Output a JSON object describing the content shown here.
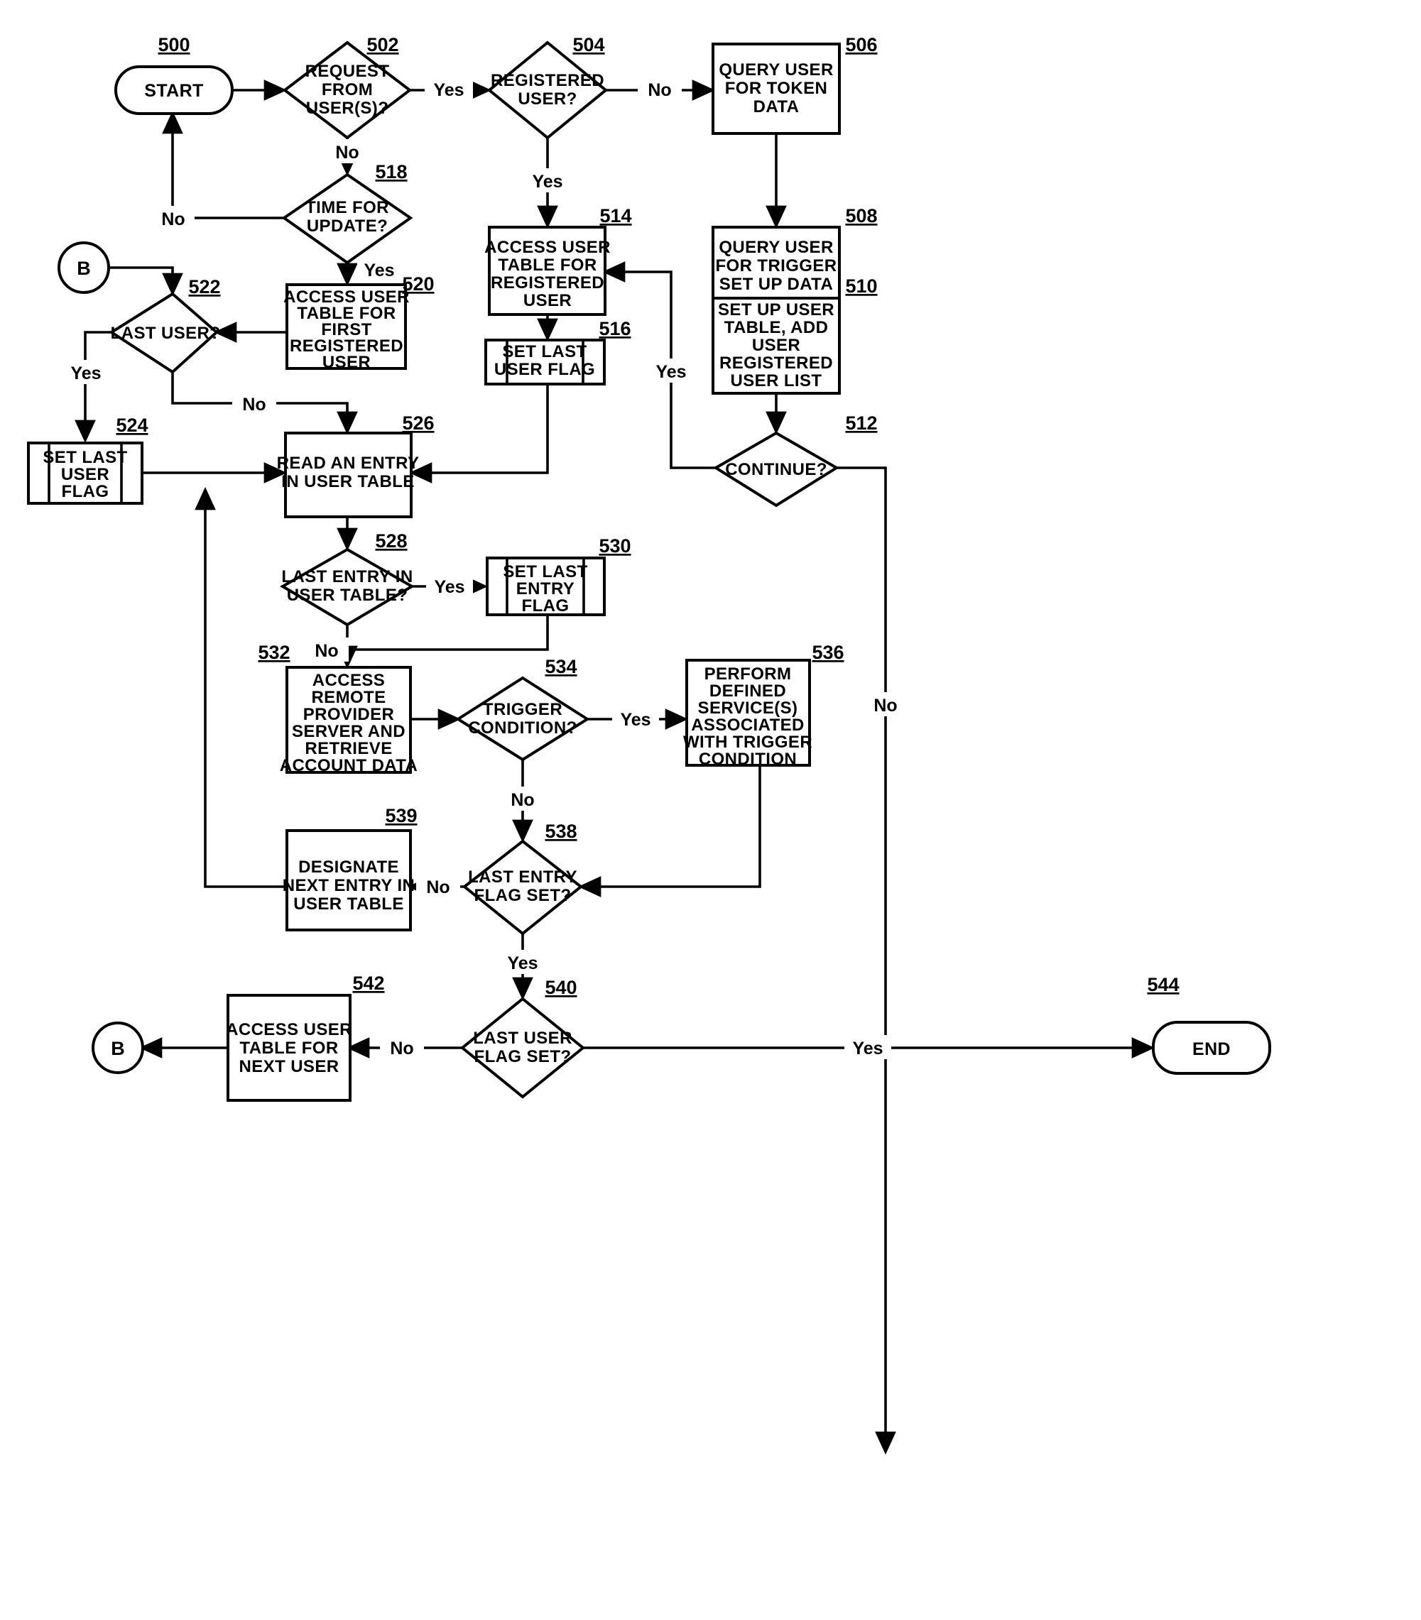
{
  "figure": {
    "type": "patent-flowchart",
    "background": "#ffffff",
    "ink": "#000000"
  },
  "nodes": {
    "n500": {
      "ref": "500",
      "shape": "terminator",
      "text": "START"
    },
    "n502": {
      "ref": "502",
      "shape": "decision",
      "line1": "REQUEST",
      "line2": "FROM",
      "line3": "USER(S)?"
    },
    "n504": {
      "ref": "504",
      "shape": "decision",
      "line1": "REGISTERED",
      "line2": "USER?"
    },
    "n506": {
      "ref": "506",
      "shape": "process",
      "line1": "QUERY USER",
      "line2": "FOR TOKEN",
      "line3": "DATA"
    },
    "n508": {
      "ref": "508",
      "shape": "process",
      "line1": "QUERY USER",
      "line2": "FOR TRIGGER",
      "line3": "SET UP DATA"
    },
    "n510": {
      "ref": "510",
      "shape": "process",
      "line1": "SET UP USER",
      "line2": "TABLE, ADD",
      "line3": "USER",
      "line4": "REGISTERED",
      "line5": "USER LIST"
    },
    "n512": {
      "ref": "512",
      "shape": "decision",
      "line1": "CONTINUE?"
    },
    "n514": {
      "ref": "514",
      "shape": "process",
      "line1": "ACCESS USER",
      "line2": "TABLE FOR",
      "line3": "REGISTERED",
      "line4": "USER"
    },
    "n516": {
      "ref": "516",
      "shape": "predefined-process",
      "line1": "SET LAST",
      "line2": "USER FLAG"
    },
    "n518": {
      "ref": "518",
      "shape": "decision",
      "line1": "TIME FOR",
      "line2": "UPDATE?"
    },
    "n520": {
      "ref": "520",
      "shape": "process",
      "line1": "ACCESS USER",
      "line2": "TABLE FOR",
      "line3": "FIRST",
      "line4": "REGISTERED",
      "line5": "USER"
    },
    "n522": {
      "ref": "522",
      "shape": "decision",
      "line1": "LAST USER?"
    },
    "n524": {
      "ref": "524",
      "shape": "predefined-process",
      "line1": "SET LAST",
      "line2": "USER",
      "line3": "FLAG"
    },
    "n526": {
      "ref": "526",
      "shape": "process",
      "line1": "READ AN ENTRY",
      "line2": "IN USER TABLE"
    },
    "n528": {
      "ref": "528",
      "shape": "decision",
      "line1": "LAST ENTRY IN",
      "line2": "USER TABLE?"
    },
    "n530": {
      "ref": "530",
      "shape": "predefined-process",
      "line1": "SET LAST",
      "line2": "ENTRY",
      "line3": "FLAG"
    },
    "n532": {
      "ref": "532",
      "shape": "process",
      "line1": "ACCESS",
      "line2": "REMOTE",
      "line3": "PROVIDER",
      "line4": "SERVER AND",
      "line5": "RETRIEVE",
      "line6": "ACCOUNT DATA"
    },
    "n534": {
      "ref": "534",
      "shape": "decision",
      "line1": "TRIGGER",
      "line2": "CONDITION?"
    },
    "n536": {
      "ref": "536",
      "shape": "process",
      "line1": "PERFORM",
      "line2": "DEFINED",
      "line3": "SERVICE(S)",
      "line4": "ASSOCIATED",
      "line5": "WITH TRIGGER",
      "line6": "CONDITION"
    },
    "n538": {
      "ref": "538",
      "shape": "decision",
      "line1": "LAST ENTRY",
      "line2": "FLAG SET?"
    },
    "n539": {
      "ref": "539",
      "shape": "process",
      "line1": "DESIGNATE",
      "line2": "NEXT ENTRY IN",
      "line3": "USER TABLE"
    },
    "n540": {
      "ref": "540",
      "shape": "decision",
      "line1": "LAST USER",
      "line2": "FLAG SET?"
    },
    "n542": {
      "ref": "542",
      "shape": "process",
      "line1": "ACCESS USER",
      "line2": "TABLE FOR",
      "line3": "NEXT USER"
    },
    "n544": {
      "ref": "544",
      "shape": "terminator",
      "text": "END"
    },
    "connector_b_top": {
      "shape": "connector",
      "text": "B"
    },
    "connector_b_bottom": {
      "shape": "connector",
      "text": "B"
    }
  },
  "edge_labels": {
    "e502_yes": "Yes",
    "e502_no": "No",
    "e504_no": "No",
    "e504_yes": "Yes",
    "e512_yes": "Yes",
    "e512_no": "No",
    "e518_no": "No",
    "e518_yes": "Yes",
    "e522_yes": "Yes",
    "e522_no": "No",
    "e528_yes": "Yes",
    "e528_no": "No",
    "e534_yes": "Yes",
    "e534_no": "No",
    "e538_no": "No",
    "e538_yes": "Yes",
    "e540_no": "No",
    "e540_yes": "Yes"
  }
}
